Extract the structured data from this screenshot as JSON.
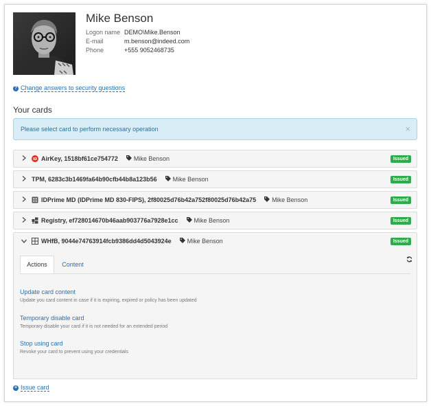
{
  "user": {
    "name": "Mike Benson",
    "fields": [
      {
        "label": "Logon name",
        "value": "DEMO\\Mike.Benson"
      },
      {
        "label": "E-mail",
        "value": "m.benson@indeed.com"
      },
      {
        "label": "Phone",
        "value": "+555 9052468735"
      }
    ]
  },
  "security_link": "Change answers to security questions",
  "cards_title": "Your cards",
  "alert": {
    "text": "Please select card to perform necessary operation",
    "close": "×"
  },
  "cards": [
    {
      "label": "AirKey, 1518bf61ce754772",
      "owner": "Mike Benson",
      "status": "Issued",
      "icon": "airkey-icon"
    },
    {
      "label": "TPM, 6283c3b1469fa64b90cfb44b8a123b56",
      "owner": "Mike Benson",
      "status": "Issued",
      "icon": "none"
    },
    {
      "label": "IDPrime MD (IDPrime MD 830-FIPS), 2f80025d76b42a752f80025d76b42a75",
      "owner": "Mike Benson",
      "status": "Issued",
      "icon": "smartcard-icon"
    },
    {
      "label": "Registry, ef728014670b46aab903776a7928e1cc",
      "owner": "Mike Benson",
      "status": "Issued",
      "icon": "registry-icon"
    },
    {
      "label": "WHfB, 9044e74763914fcb9386dd4d5043924e",
      "owner": "Mike Benson",
      "status": "Issued",
      "icon": "windows-icon"
    }
  ],
  "tabs": {
    "actions": "Actions",
    "content": "Content"
  },
  "operations": [
    {
      "title": "Update card content",
      "desc": "Update you card content in case if it is expiring, expired or policy has been updated"
    },
    {
      "title": "Temporary disable card",
      "desc": "Temporary disable your card if it is not needed for an extended period"
    },
    {
      "title": "Stop using card",
      "desc": "Revoke your card to prevent using your credentials"
    }
  ],
  "issue_link": "Issue card",
  "colors": {
    "link": "#2a6fad",
    "badge": "#2eab4c",
    "alert_bg": "#d9edf7",
    "airkey": "#e0301e"
  }
}
